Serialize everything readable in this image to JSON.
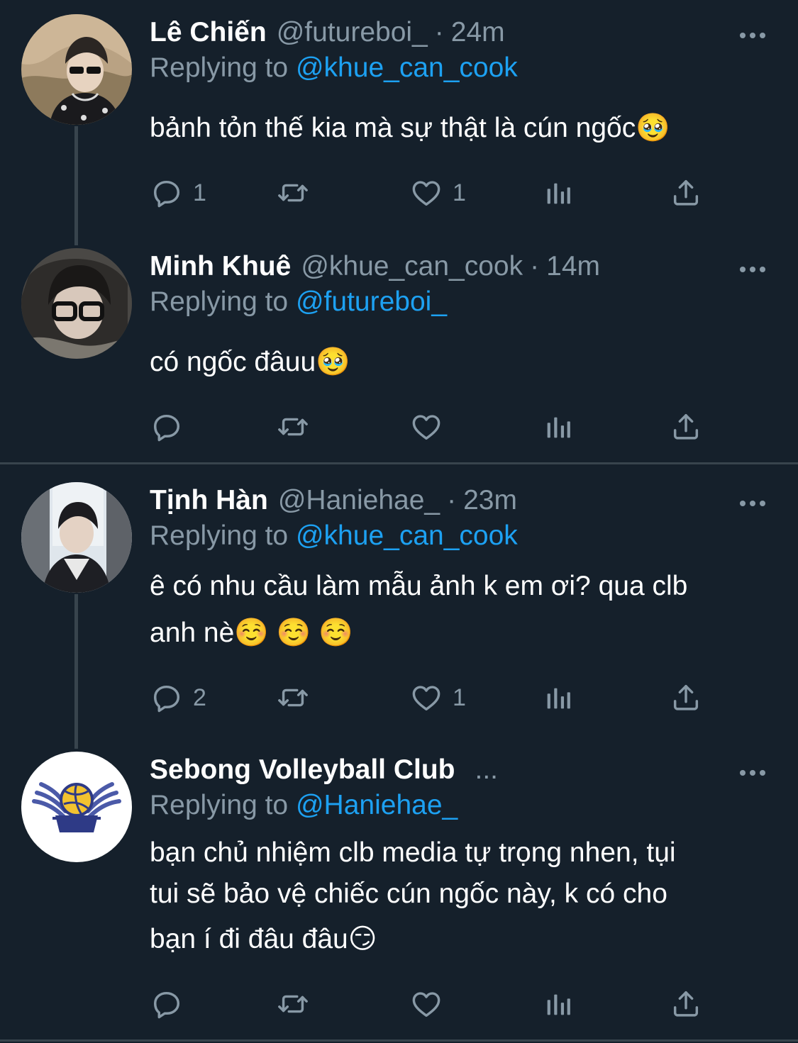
{
  "tweets": [
    {
      "name": "Lê Chiến",
      "handle": "@futureboi_",
      "time": "24m",
      "replying_label": "Replying to",
      "replying_to": "@khue_can_cook",
      "text": "bảnh tỏn thế kia mà sự thật là cún ngốc🥹",
      "reply_count": "1",
      "like_count": "1"
    },
    {
      "name": "Minh Khuê",
      "handle": "@khue_can_cook",
      "time": "14m",
      "replying_label": "Replying to",
      "replying_to": "@futureboi_",
      "text": "có ngốc đâuu🥹",
      "reply_count": "",
      "like_count": ""
    },
    {
      "name": "Tịnh Hàn",
      "handle": "@Haniehae_",
      "time": "23m",
      "replying_label": "Replying to",
      "replying_to": "@khue_can_cook",
      "text_line1": "ê có nhu cầu làm mẫu ảnh k em ơi? qua clb",
      "text_line2": "anh nè☺️ ☺️ ☺️",
      "reply_count": "2",
      "like_count": "1"
    },
    {
      "name": "Sebong Volleyball Club",
      "name_ellipsis": "...",
      "replying_label": "Replying to",
      "replying_to": "@Haniehae_",
      "text_line1": "bạn chủ nhiệm clb media tự trọng nhen, tụi",
      "text_line2": "tui sẽ bảo vệ chiếc cún ngốc này, k có cho",
      "text_line3": "bạn í đi đâu đâu😏",
      "reply_count": "",
      "like_count": ""
    }
  ],
  "separator": "·",
  "icons": {
    "reply": "reply-icon",
    "retweet": "retweet-icon",
    "like": "heart-icon",
    "analytics": "analytics-icon",
    "share": "share-icon",
    "more": "more-icon"
  },
  "colors": {
    "background": "#15202b",
    "secondary_text": "#8899a6",
    "link": "#1da1f2",
    "border": "#38444d"
  }
}
